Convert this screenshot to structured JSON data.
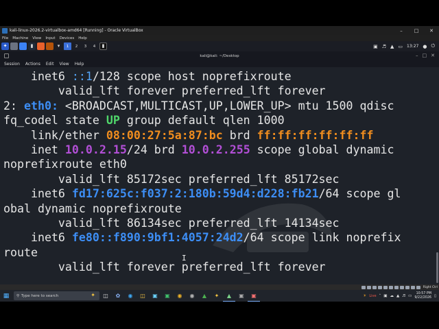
{
  "vbox": {
    "title": "kali-linux-2026.2-virtualbox-amd64 [Running] - Oracle VirtualBox",
    "win_min": "–",
    "win_max": "□",
    "win_close": "✕",
    "menu": [
      "File",
      "Machine",
      "View",
      "Input",
      "Devices",
      "Help"
    ],
    "host_key": "Right Ctrl"
  },
  "kali_panel": {
    "workspaces": [
      "1",
      "2",
      "3",
      "4"
    ],
    "active_workspace": "1",
    "clock": "13:27"
  },
  "terminal": {
    "title": "kali@kali: ~/Desktop",
    "menu": [
      "Session",
      "Actions",
      "Edit",
      "View",
      "Help"
    ],
    "lines": [
      [
        {
          "t": "    inet6 "
        },
        {
          "t": "::1",
          "c": "lblue"
        },
        {
          "t": "/128 scope host noprefixroute"
        }
      ],
      [
        {
          "t": "        valid_lft forever preferred_lft forever"
        }
      ],
      [
        {
          "t": "2: "
        },
        {
          "t": "eth0:",
          "c": "blue"
        },
        {
          "t": " <BROADCAST,MULTICAST,UP,LOWER_UP> mtu 1500 qdisc"
        }
      ],
      [
        {
          "t": "fq_codel state "
        },
        {
          "t": "UP",
          "c": "green"
        },
        {
          "t": " group default qlen 1000"
        }
      ],
      [
        {
          "t": "    link/ether "
        },
        {
          "t": "08:00:27:5a:87:bc",
          "c": "orange"
        },
        {
          "t": " brd "
        },
        {
          "t": "ff:ff:ff:ff:ff:ff",
          "c": "orange"
        }
      ],
      [
        {
          "t": "    inet "
        },
        {
          "t": "10.0.2.15",
          "c": "purple"
        },
        {
          "t": "/24 brd "
        },
        {
          "t": "10.0.2.255",
          "c": "purple"
        },
        {
          "t": " scope global dynamic"
        }
      ],
      [
        {
          "t": "noprefixroute eth0"
        }
      ],
      [
        {
          "t": "        valid_lft 85172sec preferred_lft 85172sec"
        }
      ],
      [
        {
          "t": "    inet6 "
        },
        {
          "t": "fd17:625c:f037:2:180b:59d4:d228:fb21",
          "c": "blue"
        },
        {
          "t": "/64 scope gl"
        }
      ],
      [
        {
          "t": "obal dynamic noprefixroute"
        }
      ],
      [
        {
          "t": "        valid_lft 86134sec preferred_lft 14134sec"
        }
      ],
      [
        {
          "t": "    inet6 "
        },
        {
          "t": "fe80::f890:9bf1:4057:24d2",
          "c": "blue"
        },
        {
          "t": "/64 scope link noprefix"
        }
      ],
      [
        {
          "t": "route"
        }
      ],
      [
        {
          "t": "        valid_lft forever preferred_lft forever"
        }
      ]
    ]
  },
  "taskbar": {
    "search_placeholder": "Type here to search",
    "live_label": "Live",
    "time": "10:57 PM",
    "date": "9/22/2026"
  },
  "colors": {
    "terminal_bg": "#1e2229",
    "blue": "#3d8ef5",
    "green": "#50d86b",
    "orange": "#f08d1e",
    "purple": "#b24fd6"
  }
}
